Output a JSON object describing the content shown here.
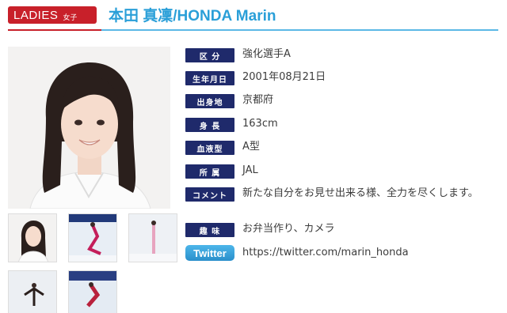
{
  "header": {
    "category_label": "LADIES",
    "category_sub": "女子",
    "athlete_name": "本田 真凜/HONDA Marin"
  },
  "colors": {
    "badge": "#c8202a",
    "name": "#2a9fd8",
    "label_bg": "#1f2a6b",
    "twitter": "#3aa6df"
  },
  "profile": {
    "rows": [
      {
        "label": "区 分",
        "value": "強化選手A"
      },
      {
        "label": "生年月日",
        "value": "2001年08月21日"
      },
      {
        "label": "出身地",
        "value": "京都府"
      },
      {
        "label": "身 長",
        "value": "163cm"
      },
      {
        "label": "血液型",
        "value": "A型"
      },
      {
        "label": "所 属",
        "value": "JAL"
      },
      {
        "label": "コメント",
        "value": "新たな自分をお見せ出来る様、全力を尽くします。"
      },
      {
        "label": "趣 味",
        "value": "お弁当作り、カメラ"
      }
    ],
    "twitter": {
      "label": "Twitter",
      "url": "https://twitter.com/marin_honda"
    }
  },
  "photos": {
    "main": "portrait-photo",
    "thumbnails": [
      "portrait-thumb",
      "skating-thumb-1",
      "skating-thumb-2",
      "skating-thumb-3",
      "skating-thumb-4"
    ]
  }
}
